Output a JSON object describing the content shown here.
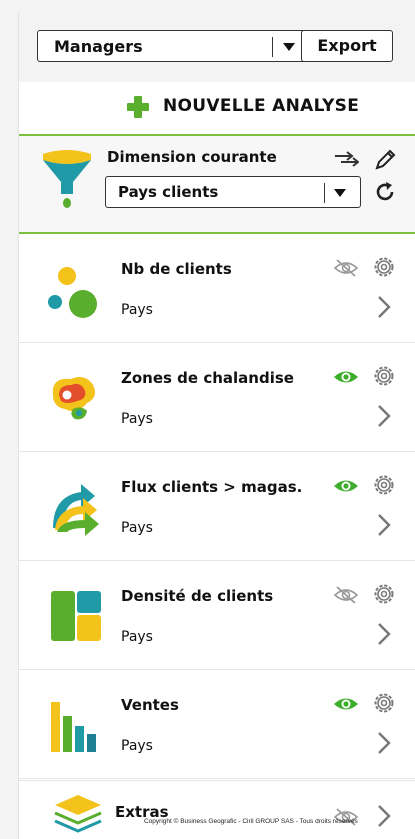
{
  "toolbar": {
    "managers_value": "Managers",
    "export_label": "Export"
  },
  "new_analysis": {
    "label": "NOUVELLE ANALYSE",
    "icon": "plus-icon"
  },
  "dimension": {
    "title": "Dimension courante",
    "selected": "Pays clients",
    "icons": [
      "funnel-icon",
      "swap-icon",
      "pencil-icon",
      "refresh-icon",
      "chevron-down-icon"
    ]
  },
  "analyses": [
    {
      "title": "Nb de clients",
      "sub": "Pays",
      "visible": false,
      "icon": "bubbles-icon"
    },
    {
      "title": "Zones de chalandise",
      "sub": "Pays",
      "visible": true,
      "icon": "zones-icon"
    },
    {
      "title": "Flux clients > magas.",
      "sub": "Pays",
      "visible": true,
      "icon": "flux-icon"
    },
    {
      "title": "Densité de clients",
      "sub": "Pays",
      "visible": false,
      "icon": "density-icon"
    },
    {
      "title": "Ventes",
      "sub": "Pays",
      "visible": true,
      "icon": "bars-icon"
    }
  ],
  "extras": {
    "title": "Extras",
    "icon": "layers-icon"
  },
  "copyright": "Copyright © Business Geografic - Ciril GROUP SAS - Tous droits réservés",
  "colors": {
    "accent_green": "#7cc23f",
    "eye_visible": "#3dae2b",
    "eye_hidden": "#9a9a9a",
    "gear": "#7a7a7a"
  }
}
